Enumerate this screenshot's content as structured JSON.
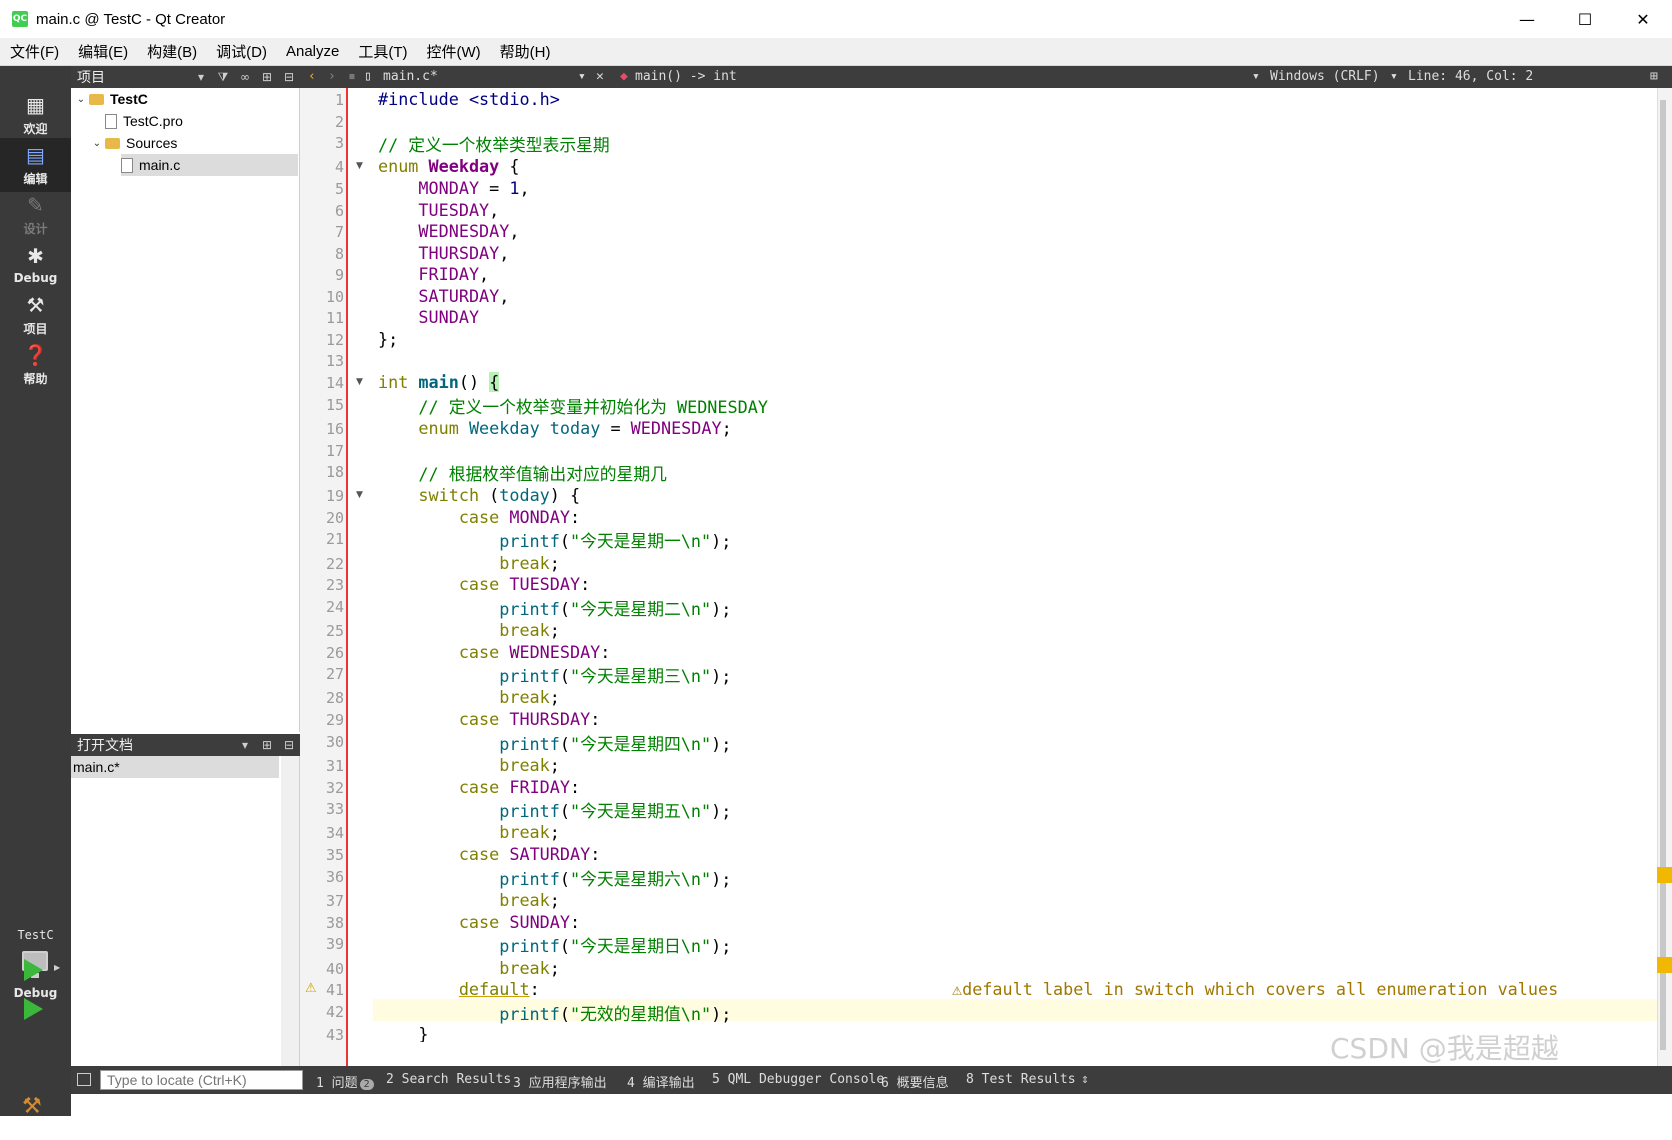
{
  "window": {
    "title": "main.c @ TestC - Qt Creator",
    "app_icon": "QC",
    "minimize": "—",
    "maximize": "☐",
    "close": "✕"
  },
  "menu": [
    "文件(F)",
    "编辑(E)",
    "构建(B)",
    "调试(D)",
    "Analyze",
    "工具(T)",
    "控件(W)",
    "帮助(H)"
  ],
  "modes": [
    {
      "label": "欢迎",
      "icon": "grid-icon"
    },
    {
      "label": "编辑",
      "icon": "edit-icon"
    },
    {
      "label": "设计",
      "icon": "pencil-icon"
    },
    {
      "label": "Debug",
      "icon": "bug-icon"
    },
    {
      "label": "项目",
      "icon": "wrench-icon"
    },
    {
      "label": "帮助",
      "icon": "help-icon"
    }
  ],
  "kit": {
    "project": "TestC",
    "build": "Debug"
  },
  "projects_panel": {
    "title": "项目",
    "tree": [
      {
        "label": "TestC",
        "level": 0
      },
      {
        "label": "TestC.pro",
        "level": 1
      },
      {
        "label": "Sources",
        "level": 1
      },
      {
        "label": "main.c",
        "level": 2
      }
    ]
  },
  "open_docs": {
    "title": "打开文档",
    "items": [
      "main.c*"
    ]
  },
  "editor_toolbar": {
    "file": "main.c*",
    "symbol": "main() -> int",
    "line_ending": "Windows (CRLF)",
    "position": "Line: 46, Col: 2"
  },
  "code": {
    "line_numbers": [
      "1",
      "2",
      "3",
      "4",
      "5",
      "6",
      "7",
      "8",
      "9",
      "10",
      "11",
      "12",
      "13",
      "14",
      "15",
      "16",
      "17",
      "18",
      "19",
      "20",
      "21",
      "22",
      "23",
      "24",
      "25",
      "26",
      "27",
      "28",
      "29",
      "30",
      "31",
      "32",
      "33",
      "34",
      "35",
      "36",
      "37",
      "38",
      "39",
      "40",
      "41",
      "42",
      "43"
    ],
    "l1a": "#include",
    "l1b": "<stdio.h>",
    "l3": "// 定义一个枚举类型表示星期",
    "l4a": "enum",
    "l4b": "Weekday",
    "l4c": "{",
    "l5a": "MONDAY",
    "l5b": "=",
    "l5c": "1",
    "l5d": ",",
    "l6": "TUESDAY",
    "l7": "WEDNESDAY",
    "l8": "THURSDAY",
    "l9": "FRIDAY",
    "l10": "SATURDAY",
    "l11": "SUNDAY",
    "comma": ",",
    "l12": "};",
    "l14a": "int",
    "l14b": "main",
    "l14c": "()",
    "l14d": "{",
    "l15": "// 定义一个枚举变量并初始化为 WEDNESDAY",
    "l16a": "enum",
    "l16b": "Weekday",
    "l16c": "today",
    "l16d": "=",
    "l16e": "WEDNESDAY",
    "l16f": ";",
    "l18": "// 根据枚举值输出对应的星期几",
    "l19a": "switch",
    "l19b": "(",
    "l19c": "today",
    "l19d": ") {",
    "case": "case",
    "colon": ":",
    "printf": "printf",
    "break": "break",
    "semi": ";",
    "lp": "(",
    "rp": ");",
    "c20": "MONDAY",
    "s21": "\"今天是星期一\\n\"",
    "c23": "TUESDAY",
    "s24": "\"今天是星期二\\n\"",
    "c26": "WEDNESDAY",
    "s27": "\"今天是星期三\\n\"",
    "c29": "THURSDAY",
    "s30": "\"今天是星期四\\n\"",
    "c32": "FRIDAY",
    "s33": "\"今天是星期五\\n\"",
    "c35": "SATURDAY",
    "s36": "\"今天是星期六\\n\"",
    "c38": "SUNDAY",
    "s39": "\"今天是星期日\\n\"",
    "l41": "default",
    "s42": "\"无效的星期值\\n\"",
    "l43": "}",
    "warning": "default label in switch which covers all enumeration values"
  },
  "statusbar": {
    "locator_placeholder": "Type to locate (Ctrl+K)",
    "tabs": [
      "1 问题",
      "2 Search Results",
      "3 应用程序输出",
      "4 编译输出",
      "5 QML Debugger Console",
      "6 概要信息",
      "8 Test Results"
    ],
    "issues_count": "2"
  },
  "watermark": "CSDN @我是超越",
  "colors": {
    "keyword": "#808000",
    "comment": "#008000",
    "enum_value": "#800080",
    "function": "#00677c",
    "gutter_line": "#ee3333"
  }
}
